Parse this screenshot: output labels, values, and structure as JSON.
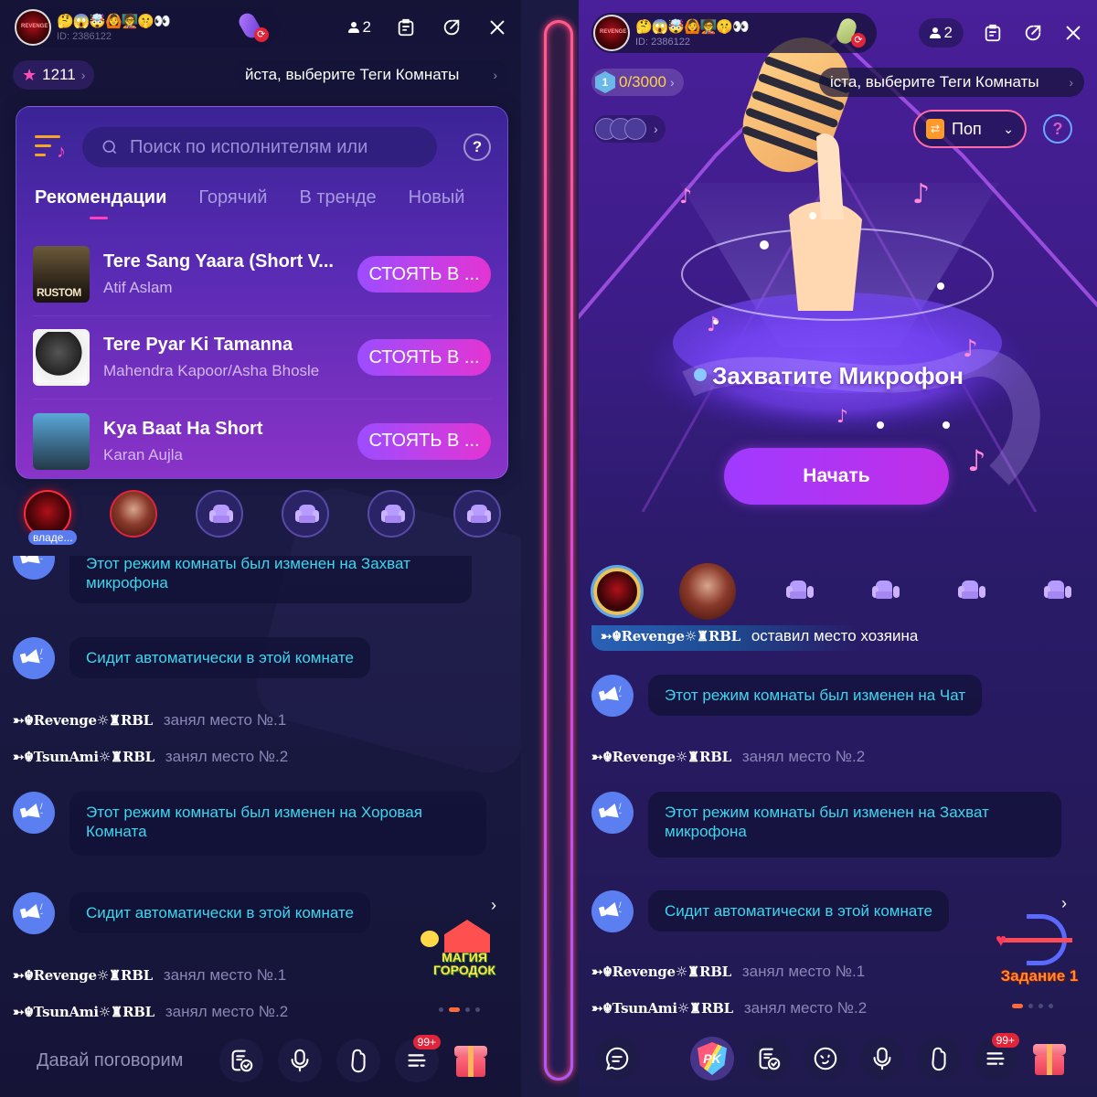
{
  "left": {
    "header": {
      "room_emojis": "🤔😱🤯🙆🧑‍🏫🤫👀",
      "room_id": "ID: 2386122",
      "online_count": "2",
      "icons": [
        "room-avatar",
        "mic-mode-icon",
        "person-icon",
        "notice-board-icon",
        "share-icon",
        "close-icon"
      ]
    },
    "stars": {
      "value": "1211",
      "chevron": "›"
    },
    "tags": {
      "text": "йста, выберите Теги Комнаты",
      "chevron": "›"
    },
    "song_panel": {
      "search_placeholder": "Поиск по исполнителям или",
      "help": "?",
      "tabs": [
        {
          "label": "Рекомендации",
          "active": true
        },
        {
          "label": "Горячий",
          "active": false
        },
        {
          "label": "В тренде",
          "active": false
        },
        {
          "label": "Новый",
          "active": false
        }
      ],
      "songs": [
        {
          "title": "Tere Sang Yaara  (Short V...",
          "artist": "Atif Aslam",
          "button": "СТОЯТЬ В ..."
        },
        {
          "title": "Tere Pyar Ki Tamanna",
          "artist": "Mahendra Kapoor/Asha Bhosle",
          "button": "СТОЯТЬ В ..."
        },
        {
          "title": "Kya Baat Ha Short",
          "artist": "Karan Aujla",
          "button": "СТОЯТЬ В ..."
        }
      ]
    },
    "seats": {
      "owner_badge": "владе...",
      "empty_count": 4
    },
    "messages": {
      "m0": "Этот режим комнаты был изменен на Захват микрофона",
      "m1": "Сидит автоматически в этой комнате",
      "s1_user": "➳☬Revenge☼♜RBL",
      "s1_action": "занял место №.1",
      "s2_user": "➳☬TsunAmi☼♜RBL",
      "s2_action": "занял место №.2",
      "m2": "Этот режим комнаты был изменен на Хоровая Комната",
      "m3": "Сидит автоматически в этой комнате",
      "s3_user": "➳☬Revenge☼♜RBL",
      "s3_action": "занял место №.1",
      "s4_user": "➳☬TsunAmi☼♜RBL",
      "s4_action": "занял место №.2"
    },
    "promo": {
      "label": "МАГИЯ ГОРОДОК",
      "chevron": "›",
      "pages": 4,
      "active_page": 2
    },
    "bottom": {
      "chat_placeholder": "Давай поговорим",
      "badge": "99+"
    }
  },
  "right": {
    "header": {
      "room_emojis": "🤔😱🤯🙆🧑‍🏫🤫👀",
      "room_id": "ID: 2386122",
      "online_count": "2"
    },
    "level": {
      "value": "0/3000",
      "level_num": "1",
      "chevron": "›"
    },
    "tags": {
      "text": "іста, выберите Теги Комнаты",
      "chevron": "›"
    },
    "genre": {
      "label": "Поп",
      "icon": "⇄",
      "dropdown": "⌄"
    },
    "help": "?",
    "hero": {
      "title": "Захватите Микрофон",
      "start_button": "Начать"
    },
    "host_left": {
      "user": "➳☬Revenge☼♜RBL",
      "action": "оставил место хозяина"
    },
    "messages": {
      "m1": "Этот режим комнаты был изменен на Чат",
      "s1_user": "➳☬Revenge☼♜RBL",
      "s1_action": "занял место №.2",
      "m2": "Этот режим комнаты был изменен на Захват микрофона",
      "m3": "Сидит автоматически в этой комнате",
      "s2_user": "➳☬Revenge☼♜RBL",
      "s2_action": "занял место №.1",
      "s3_user": "➳☬TsunAmi☼♜RBL",
      "s3_action": "занял место №.2"
    },
    "promo": {
      "label": "Задание 1",
      "chevron": "›",
      "pages": 4,
      "active_page": 1
    },
    "bottom": {
      "badge": "99+",
      "pk_label": "PK"
    }
  },
  "colors": {
    "accent_pink": "#e434d2",
    "accent_purple": "#9c4dff",
    "system_text": "#3ed6ee",
    "megaphone_bg": "#5b7ff0",
    "badge_red": "#e0243a",
    "star_pink": "#ff4fb6",
    "level_gold": "#ffd04a"
  }
}
